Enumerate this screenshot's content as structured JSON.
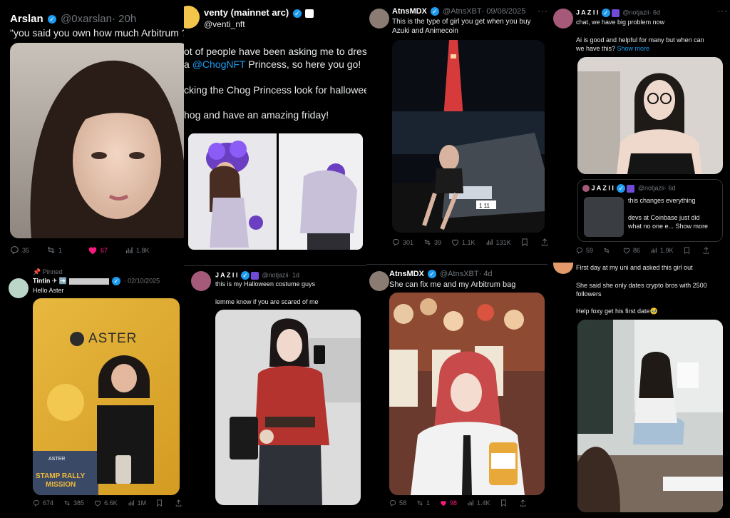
{
  "t1": {
    "name": "Arslan",
    "handle": "@0xarslan",
    "time": "· 20h",
    "text": "\"you said you own how much Arbitrum ?\"",
    "replies": "35",
    "reposts": "1",
    "likes": "67",
    "views": "1.8K"
  },
  "t2": {
    "name": "venty (mainnet arc)",
    "handle": "@venti_nft",
    "line1": "ot of people have been asking me to dress",
    "line2_pre": "a ",
    "line2_link": "@ChogNFT",
    "line2_post": " Princess, so here you go!",
    "line3": "cking the Chog Princess look for halloween",
    "line4": "hog and have an amazing friday!"
  },
  "t3": {
    "name": "AtnsMDX",
    "handle": "@AtnsXBT",
    "time": "· 09/08/2025",
    "line1": "This is the type of girl you get when you buy",
    "line2": "Azuki and Animecoin",
    "plate": "1 11",
    "replies": "301",
    "reposts": "39",
    "likes": "1.1K",
    "views": "131K"
  },
  "t4": {
    "name": "J A Z I I",
    "handle": "@notjazii",
    "time": "· 6d",
    "line1": "chat, we have big problem now",
    "line2": "Ai is good and helpful for many but when can",
    "line3_pre": "we have this? ",
    "line3_link": "Show more",
    "quote": {
      "name": "J A Z I I",
      "handle": "@notjazii",
      "time": "· 6d",
      "line1": "this changes everything",
      "line2": "devs at Coinbase just did",
      "line3": "what no one e... Show more"
    },
    "replies": "59",
    "likes": "86",
    "views": "1.9K"
  },
  "t5": {
    "pinned": "Pinned",
    "name": "Tintin",
    "name_suffix": "✈ ➡️",
    "date": "· 02/10/2025",
    "text": "Hello Aster",
    "brand": "ASTER",
    "brand_small": "ASTER",
    "stamp1": "STAMP RALLY",
    "stamp2": "MISSION",
    "replies": "674",
    "reposts": "385",
    "likes": "6.6K",
    "views": "1M"
  },
  "t6": {
    "name": "J A Z I I",
    "handle": "@notjazii",
    "time": "· 1d",
    "line1": "this is my Halloween costume guys",
    "line2": "lemme know if you are scared of me"
  },
  "t7": {
    "name": "AtnsMDX",
    "handle": "@AtnsXBT",
    "time": "· 4d",
    "text": "She can fix me and my Arbitrum bag",
    "replies": "58",
    "reposts": "1",
    "likes": "98",
    "views": "1.4K"
  },
  "t8": {
    "line1": "First day at my uni and asked this girl out",
    "line2": "She said she only dates crypto bros with 2500",
    "line3": "followers",
    "line4": "Help foxy get his first date🥹"
  },
  "colors": {
    "accent": "#1d9bf0",
    "like": "#f91880",
    "muted": "#71767b",
    "border": "#2f3336"
  }
}
